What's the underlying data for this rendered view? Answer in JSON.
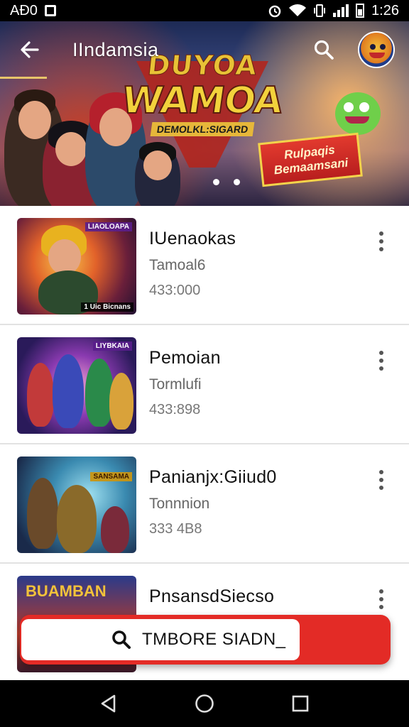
{
  "status_bar": {
    "left_text": "AÐ0",
    "time": "1:26"
  },
  "app_bar": {
    "title": "IIndamsia"
  },
  "banner": {
    "logo_top": "DUYOA",
    "logo_main": "WAMOA",
    "logo_sub": "DEMOLKL:SIGARD",
    "badge_line1": "Rulpaqis",
    "badge_line2": "Bemaamsani",
    "page_count": 2
  },
  "items": [
    {
      "title": "IUenaokas",
      "subtitle": "Tamoal6",
      "count": "433:000",
      "thumb_top": "LIAOLOAPA",
      "thumb_bottom": "1 Uic Bicnans"
    },
    {
      "title": "Pemoian",
      "subtitle": "Tormlufi",
      "count": "433:898",
      "thumb_top": "LIYBKAIA",
      "thumb_bottom": ""
    },
    {
      "title": "Panianjx:Giiud0",
      "subtitle": "Tonnnion",
      "count": "333 4B8",
      "thumb_top": "SANSAMA",
      "thumb_bottom": ""
    },
    {
      "title": "PnsansdSiecso",
      "subtitle": "",
      "count": "",
      "thumb_top": "BUAMBAN",
      "thumb_bottom": ""
    }
  ],
  "floating_search": {
    "label": "TMBORE SIADN_"
  },
  "colors": {
    "accent": "#e32b26",
    "status_bar": "#000000"
  }
}
